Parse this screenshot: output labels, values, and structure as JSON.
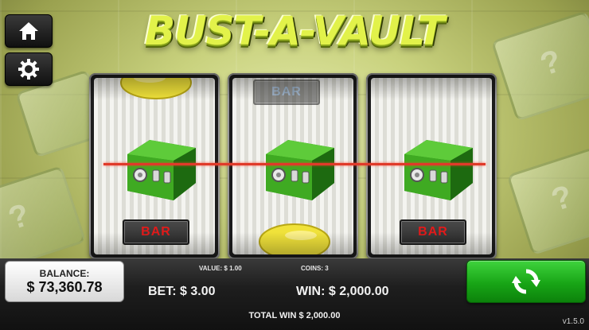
{
  "game": {
    "title": "BUST-A-VAULT",
    "version": "v1.5.0"
  },
  "nav": {
    "home_icon": "home-icon",
    "settings_icon": "gear-icon"
  },
  "reels": [
    {
      "top": "lemon",
      "middle": "vault",
      "bottom": "BAR"
    },
    {
      "top": "BAR",
      "middle": "vault",
      "bottom": "lemon"
    },
    {
      "top": "blank",
      "middle": "vault",
      "bottom": "BAR"
    }
  ],
  "symbols": {
    "bar_label": "BAR"
  },
  "balance": {
    "label": "BALANCE:",
    "value": "$ 73,360.78"
  },
  "bet_info": {
    "value_label": "VALUE:  $ 1.00",
    "coins_label": "COINS:  3",
    "bet_label": "BET:  $ 3.00",
    "win_label": "WIN:  $ 2,000.00"
  },
  "total_win": "TOTAL WIN $ 2,000.00",
  "spin_button": {
    "icon": "refresh-icon"
  },
  "colors": {
    "title": "#e2f24a",
    "spin_green": "#18a516",
    "payline_red": "#e03a2a",
    "bar_text": "#e21a1a"
  }
}
